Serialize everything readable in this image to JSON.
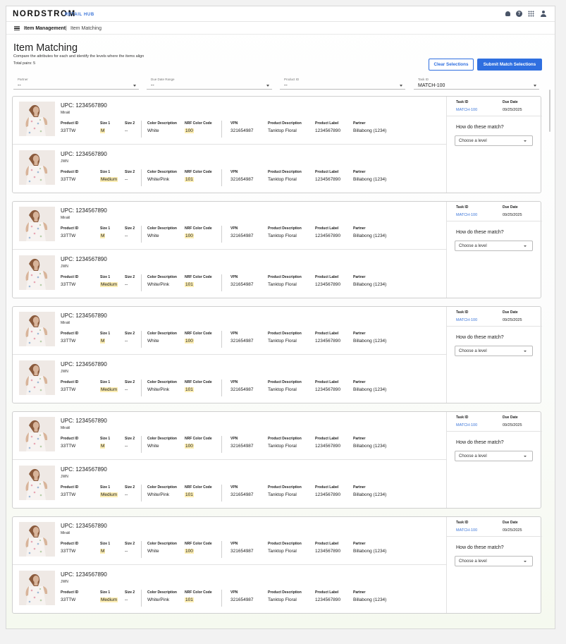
{
  "header": {
    "brand": "NORDSTROM",
    "hub_label": "RETAIL HUB",
    "icons": [
      "bell-icon",
      "help-icon",
      "apps-grid-icon",
      "user-icon"
    ]
  },
  "breadcrumb": {
    "menu_icon": "hamburger-icon",
    "item_1": "Item Management",
    "separator": "|",
    "item_2": "Item Matching"
  },
  "page": {
    "title": "Item Matching",
    "subtitle": "Compare the attributes for each and identify the levels where the items align",
    "total_pairs": "Total pairs: 5"
  },
  "actions": {
    "clear_label": "Clear Selections",
    "submit_label": "Submit Match Selections"
  },
  "filters": [
    {
      "label": "Partner",
      "value": "--"
    },
    {
      "label": "Due Date Range",
      "value": "--"
    },
    {
      "label": "Product ID",
      "value": "--"
    },
    {
      "label": "Task ID",
      "value": "MATCH-100"
    }
  ],
  "columns": {
    "product_id": "Product ID",
    "size1": "Size 1",
    "size2": "Size 2",
    "color_desc": "Color Description",
    "nrf": "NRF Color Code",
    "vpn": "VPN",
    "prod_desc": "Product Description",
    "prod_label": "Product Label",
    "partner": "Partner"
  },
  "side": {
    "task_id_label": "Task ID",
    "due_date_label": "Due Date",
    "question": "How do these match?",
    "select_placeholder": "Choose a level"
  },
  "pairs": [
    {
      "task_id": "MATCH-100",
      "due_date": "09/25/2025",
      "items": [
        {
          "upc": "UPC: 1234567890",
          "source": "Mirakl",
          "product_id": "33TTW",
          "size1": "M",
          "size2": "--",
          "color_desc": "White",
          "nrf": "100",
          "vpn": "321654987",
          "prod_desc": "Tanktop Floral",
          "prod_label": "1234567890",
          "partner": "Billabong (1234)"
        },
        {
          "upc": "UPC: 1234567890",
          "source": "JWN",
          "product_id": "33TTW",
          "size1": "Medium",
          "size2": "--",
          "color_desc": "White/Pink",
          "nrf": "101",
          "vpn": "321654987",
          "prod_desc": "Tanktop Floral",
          "prod_label": "1234567890",
          "partner": "Billabong (1234)"
        }
      ]
    },
    {
      "task_id": "MATCH-100",
      "due_date": "09/25/2025",
      "items": [
        {
          "upc": "UPC: 1234567890",
          "source": "Mirakl",
          "product_id": "33TTW",
          "size1": "M",
          "size2": "--",
          "color_desc": "White",
          "nrf": "100",
          "vpn": "321654987",
          "prod_desc": "Tanktop Floral",
          "prod_label": "1234567890",
          "partner": "Billabong (1234)"
        },
        {
          "upc": "UPC: 1234567890",
          "source": "JWN",
          "product_id": "33TTW",
          "size1": "Medium",
          "size2": "--",
          "color_desc": "White/Pink",
          "nrf": "101",
          "vpn": "321654987",
          "prod_desc": "Tanktop Floral",
          "prod_label": "1234567890",
          "partner": "Billabong (1234)"
        }
      ]
    },
    {
      "task_id": "MATCH-100",
      "due_date": "09/25/2025",
      "items": [
        {
          "upc": "UPC: 1234567890",
          "source": "Mirakl",
          "product_id": "33TTW",
          "size1": "M",
          "size2": "--",
          "color_desc": "White",
          "nrf": "100",
          "vpn": "321654987",
          "prod_desc": "Tanktop Floral",
          "prod_label": "1234567890",
          "partner": "Billabong (1234)"
        },
        {
          "upc": "UPC: 1234567890",
          "source": "JWN",
          "product_id": "33TTW",
          "size1": "Medium",
          "size2": "--",
          "color_desc": "White/Pink",
          "nrf": "101",
          "vpn": "321654987",
          "prod_desc": "Tanktop Floral",
          "prod_label": "1234567890",
          "partner": "Billabong (1234)"
        }
      ]
    },
    {
      "task_id": "MATCH-100",
      "due_date": "09/25/2025",
      "items": [
        {
          "upc": "UPC: 1234567890",
          "source": "Mirakl",
          "product_id": "33TTW",
          "size1": "M",
          "size2": "--",
          "color_desc": "White",
          "nrf": "100",
          "vpn": "321654987",
          "prod_desc": "Tanktop Floral",
          "prod_label": "1234567890",
          "partner": "Billabong (1234)"
        },
        {
          "upc": "UPC: 1234567890",
          "source": "JWN",
          "product_id": "33TTW",
          "size1": "Medium",
          "size2": "--",
          "color_desc": "White/Pink",
          "nrf": "101",
          "vpn": "321654987",
          "prod_desc": "Tanktop Floral",
          "prod_label": "1234567890",
          "partner": "Billabong (1234)"
        }
      ]
    },
    {
      "task_id": "MATCH-100",
      "due_date": "09/25/2025",
      "items": [
        {
          "upc": "UPC: 1234567890",
          "source": "Mirakl",
          "product_id": "33TTW",
          "size1": "M",
          "size2": "--",
          "color_desc": "White",
          "nrf": "100",
          "vpn": "321654987",
          "prod_desc": "Tanktop Floral",
          "prod_label": "1234567890",
          "partner": "Billabong (1234)"
        },
        {
          "upc": "UPC: 1234567890",
          "source": "JWN",
          "product_id": "33TTW",
          "size1": "Medium",
          "size2": "--",
          "color_desc": "White/Pink",
          "nrf": "101",
          "vpn": "321654987",
          "prod_desc": "Tanktop Floral",
          "prod_label": "1234567890",
          "partner": "Billabong (1234)"
        }
      ]
    }
  ],
  "colors": {
    "accent": "#2f6fe0",
    "highlight": "#fdeeb3",
    "link": "#3a74d8"
  }
}
